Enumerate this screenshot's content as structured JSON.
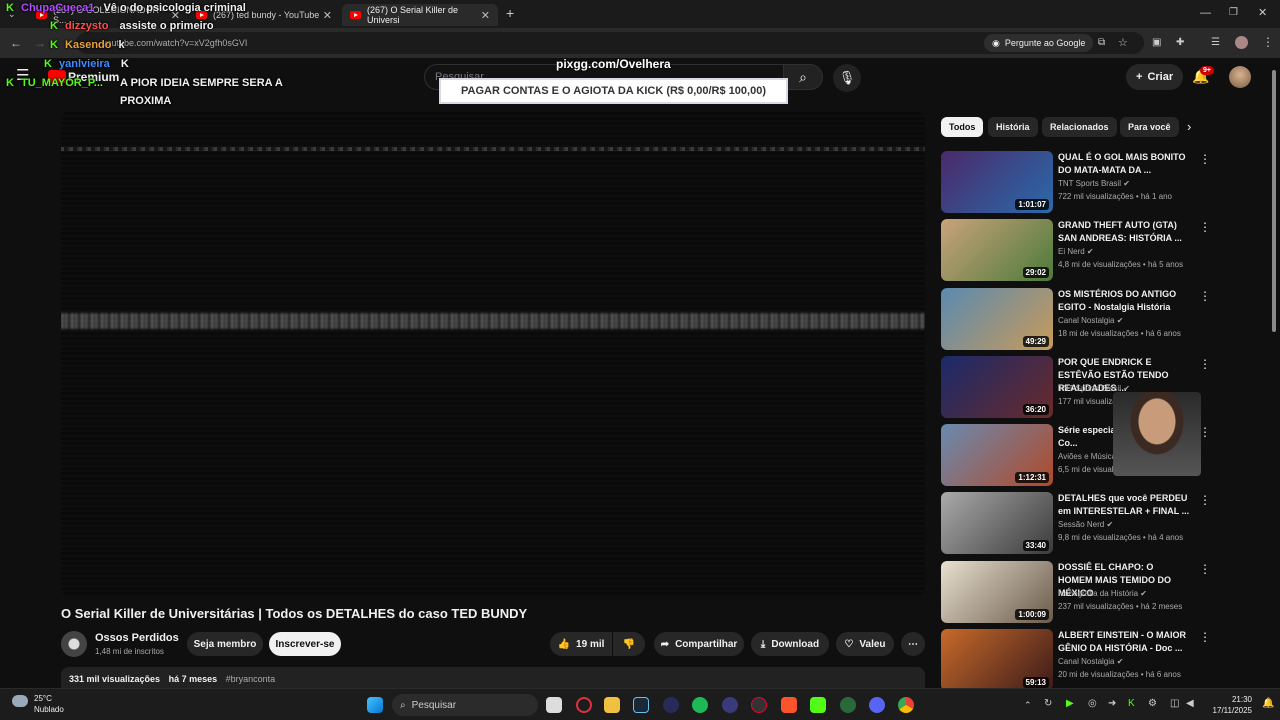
{
  "browser": {
    "tabs": [
      {
        "label": "(267) O COLECIONADOR - S...",
        "active": false
      },
      {
        "label": "(267) ted bundy - YouTube",
        "active": false
      },
      {
        "label": "(267) O Serial Killer de Universi",
        "active": true
      }
    ],
    "url": "youtube.com/watch?v=xV2gfh0sGVI",
    "ask_google": "Pergunte ao Google"
  },
  "youtube": {
    "logo_suffix": "Premium",
    "search_placeholder": "Pesquisar",
    "create_label": "Criar",
    "notif_count": "9+"
  },
  "overlay": {
    "chat": [
      {
        "user": "ChupaCueca1",
        "user_color": "#b04cff",
        "msg": "Vê o do psicologia criminal"
      },
      {
        "user": "dizzysto",
        "user_color": "#ff4d4d",
        "msg": "assiste o primeiro"
      },
      {
        "user": "Kasendo",
        "user_color": "#e8a33d",
        "msg": "k"
      },
      {
        "user": "yanlvieira",
        "user_color": "#3d8bff",
        "msg": "K"
      },
      {
        "user": "TU_MAYOR_P...",
        "user_color": "#53fc18",
        "msg": "A PIOR IDEIA SEMPRE SERA A"
      },
      {
        "user": "",
        "user_color": "#53fc18",
        "msg": "PROXIMA"
      }
    ],
    "url_text": "pixgg.com/Ovelhera",
    "goal_text": "PAGAR CONTAS E O AGIOTA DA KICK (R$ 0,00/R$ 100,00)"
  },
  "video": {
    "title": "O Serial Killer de Universitárias | Todos os DETALHES do caso TED BUNDY",
    "channel": "Ossos Perdidos",
    "subscribers": "1,48 mi de inscritos",
    "join_label": "Seja membro",
    "subscribe_label": "Inscrever-se",
    "likes": "19 mil",
    "share_label": "Compartilhar",
    "download_label": "Download",
    "thanks_label": "Valeu",
    "views": "331 mil visualizações",
    "age": "há 7 meses",
    "hashtag": "#bryanconta"
  },
  "chips": [
    "Todos",
    "História",
    "Relacionados",
    "Para você"
  ],
  "recommendations": [
    {
      "title": "QUAL É O GOL MAIS BONITO DO MATA-MATA DA ...",
      "channel": "TNT Sports Brasil",
      "meta": "722 mil visualizações • há 1 ano",
      "duration": "1:01:07",
      "colors": [
        "#4a2a6a",
        "#2a6aaa"
      ]
    },
    {
      "title": "GRAND THEFT AUTO (GTA) SAN ANDREAS: HISTÓRIA ...",
      "channel": "Ei Nerd",
      "meta": "4,8 mi de visualizações • há 5 anos",
      "duration": "29:02",
      "colors": [
        "#c9a37a",
        "#4c7a3a"
      ]
    },
    {
      "title": "OS MISTÉRIOS DO ANTIGO EGITO - Nostalgia História",
      "channel": "Canal Nostalgia",
      "meta": "18 mi de visualizações • há 6 anos",
      "duration": "49:29",
      "colors": [
        "#5a8ab0",
        "#c89a5a"
      ]
    },
    {
      "title": "POR QUE ENDRICK E ESTÊVÃO ESTÃO TENDO REALIDADES ...",
      "channel": "TNT Sports Brasil",
      "meta": "177 mil visualizações • há 2 semanas",
      "duration": "36:20",
      "colors": [
        "#1a2a6a",
        "#6a2a2a"
      ]
    },
    {
      "title": "Série especial 11 de Setembro Co...",
      "channel": "Aviões e Músicas",
      "meta": "6,5 mi de visualizações",
      "duration": "1:12:31",
      "colors": [
        "#6a8ab0",
        "#b04a2a"
      ]
    },
    {
      "title": "DETALHES que você PERDEU em INTERESTELAR + FINAL ...",
      "channel": "Sessão Nerd",
      "meta": "9,8 mi de visualizações • há 4 anos",
      "duration": "33:40",
      "colors": [
        "#aaaaaa",
        "#3a3a3a"
      ]
    },
    {
      "title": "DOSSIÊ EL CHAPO: O HOMEM MAIS TEMIDO DO MÉXICO",
      "channel": "Iconografia da História",
      "meta": "237 mil visualizações • há 2 meses",
      "duration": "1:00:09",
      "colors": [
        "#e8e0d0",
        "#6a5a4a"
      ]
    },
    {
      "title": "ALBERT EINSTEIN - O MAIOR GÊNIO DA HISTÓRIA - Doc ...",
      "channel": "Canal Nostalgia",
      "meta": "20 mi de visualizações • há 6 anos",
      "duration": "59:13",
      "colors": [
        "#c86a2a",
        "#3a1a1a"
      ]
    }
  ],
  "taskbar": {
    "temp": "25°C",
    "weather": "Nublado",
    "search": "Pesquisar",
    "time": "21:30",
    "date": "17/11/2025"
  }
}
